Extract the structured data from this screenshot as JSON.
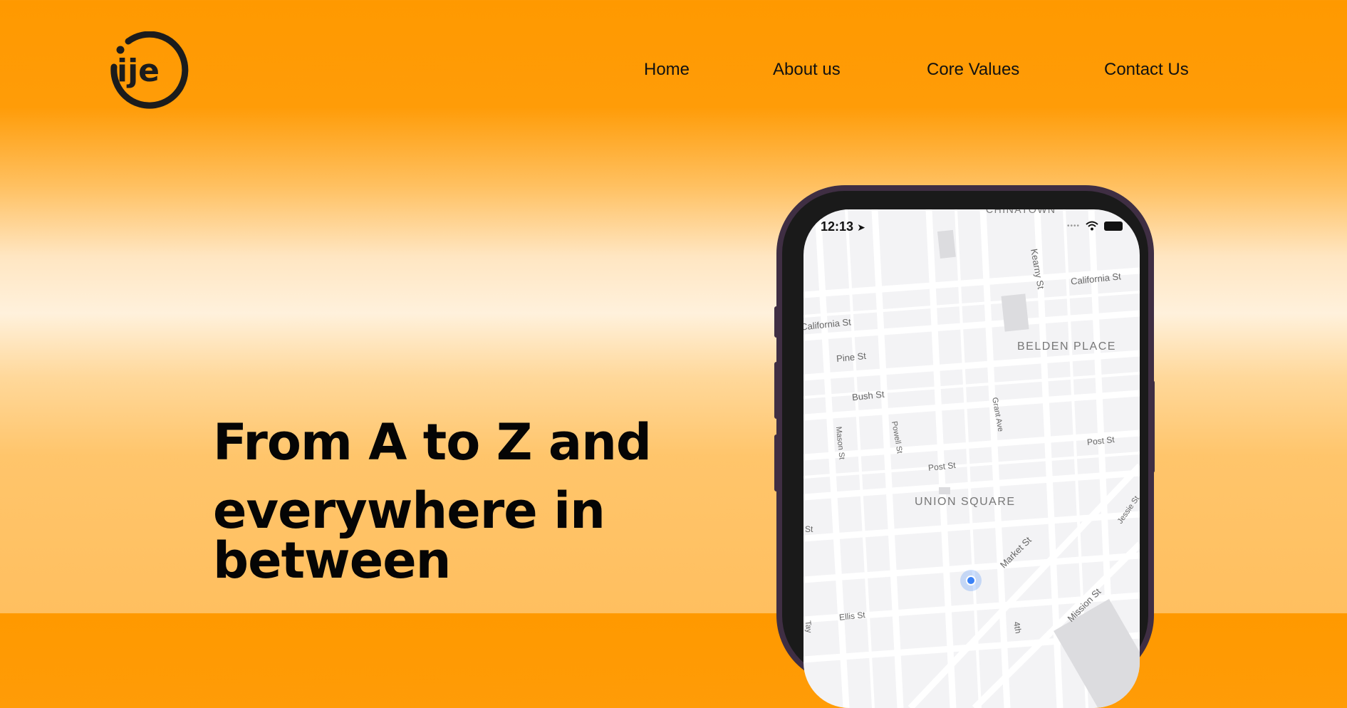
{
  "header": {
    "logo_text": "ije",
    "nav": [
      {
        "label": "Home"
      },
      {
        "label": "About us"
      },
      {
        "label": "Core Values"
      },
      {
        "label": "Contact Us"
      }
    ]
  },
  "hero": {
    "line1": "From A to Z and",
    "line2": "everywhere in",
    "line3": "between"
  },
  "phone": {
    "status_time": "12:13",
    "map_labels": {
      "chinatown": "CHINATOWN",
      "kearny": "Kearny St",
      "california_right": "California St",
      "california_left": "California St",
      "belden": "BELDEN PLACE",
      "pine": "Pine St",
      "bush": "Bush St",
      "grant": "Grant Ave",
      "mason": "Mason St",
      "powell": "Powell St",
      "post_right": "Post St",
      "post_mid": "Post St",
      "union": "UNION SQUARE",
      "jessie": "Jessie St",
      "st_left": "St",
      "market": "Market St",
      "ellis": "Ellis St",
      "mission": "Mission St",
      "fourth": "4th",
      "taylor": "Tay"
    }
  },
  "colors": {
    "brand_orange": "#ff9900",
    "text_dark": "#111111",
    "location_dot": "#3b82f6"
  }
}
